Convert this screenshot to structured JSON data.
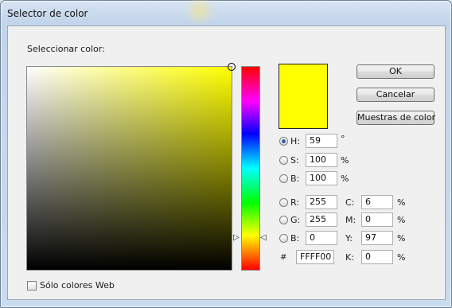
{
  "window": {
    "title": "Selector de color"
  },
  "picker": {
    "heading": "Seleccionar color:",
    "web_only_label": "Sólo colores Web",
    "web_only_checked": false,
    "hue_position_fraction": 0.84
  },
  "current_color": "#ffff00",
  "buttons": {
    "ok": "OK",
    "cancel": "Cancelar",
    "swatches": "Muestras de color"
  },
  "hsb": {
    "h_label": "H:",
    "h_value": "59",
    "h_unit": "°",
    "h_selected": true,
    "s_label": "S:",
    "s_value": "100",
    "s_unit": "%",
    "s_selected": false,
    "b_label": "B:",
    "b_value": "100",
    "b_unit": "%",
    "b_selected": false
  },
  "rgb": {
    "r_label": "R:",
    "r_value": "255",
    "g_label": "G:",
    "g_value": "255",
    "b_label": "B:",
    "b_value": "0"
  },
  "cmyk": {
    "c_label": "C:",
    "c_value": "6",
    "c_unit": "%",
    "m_label": "M:",
    "m_value": "0",
    "m_unit": "%",
    "y_label": "Y:",
    "y_value": "97",
    "y_unit": "%",
    "k_label": "K:",
    "k_value": "0",
    "k_unit": "%"
  },
  "hex": {
    "label": "#",
    "value": "FFFF00"
  },
  "icons": [
    "radio-icon",
    "checkbox-icon",
    "hue-slider-arrow-icon"
  ]
}
